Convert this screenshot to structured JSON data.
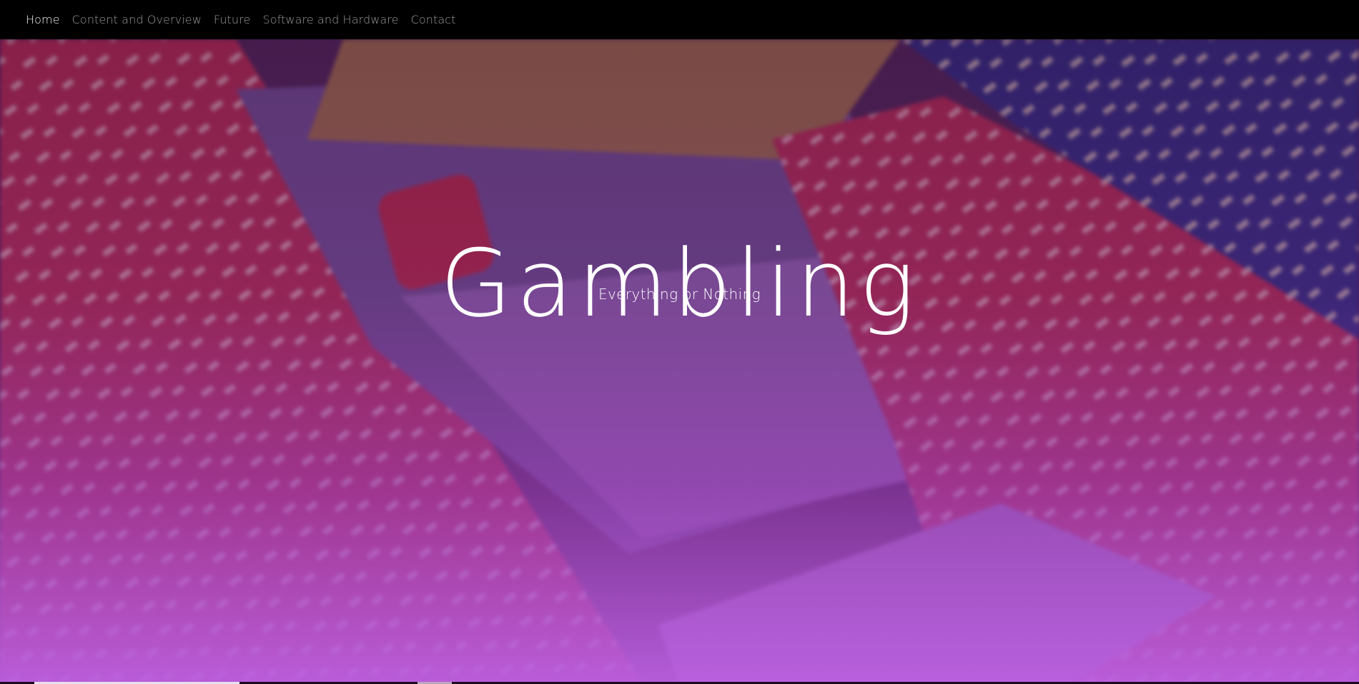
{
  "nav": {
    "items": [
      {
        "label": "Home",
        "active": true
      },
      {
        "label": "Content and Overview",
        "active": false
      },
      {
        "label": "Future",
        "active": false
      },
      {
        "label": "Software and Hardware",
        "active": false
      },
      {
        "label": "Contact",
        "active": false
      }
    ]
  },
  "hero": {
    "title": "Gambling",
    "subtitle": "Everything or Nothing",
    "background_description": "poker-chips-cards-dice-photo"
  },
  "colors": {
    "nav_bg": "#000000",
    "nav_text": "#9a9a9a",
    "nav_text_active": "#f3f3f3",
    "hero_gradient_bottom": "#ba5fe0",
    "title_color": "#ffffff"
  }
}
